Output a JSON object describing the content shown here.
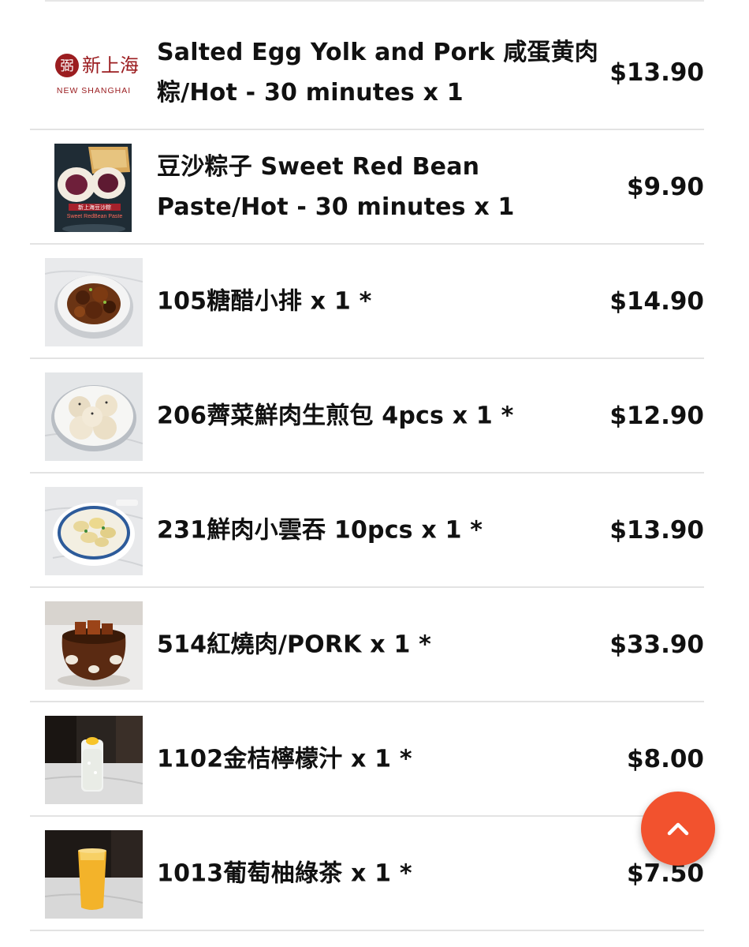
{
  "brand": {
    "logo_glyph": "弼",
    "logo_cn": "新上海",
    "logo_en": "NEW SHANGHAI"
  },
  "photo_text": {
    "cn": "新上海豆沙粽",
    "en": "Sweet RedBean Paste"
  },
  "colors": {
    "accent": "#f2522e",
    "brand_red": "#9b1d20",
    "text": "#111111",
    "divider": "#e3e3e3"
  },
  "scroll_top_button": {
    "icon": "chevron-up-icon"
  },
  "order_items": [
    {
      "title": "Salted Egg Yolk and Pork 咸蛋黄肉粽/Hot - 30 minutes x 1",
      "price": "$13.90",
      "thumb": "new-shanghai-logo"
    },
    {
      "title": "豆沙粽子 Sweet Red Bean Paste/Hot - 30 minutes x 1",
      "price": "$9.90",
      "thumb": "red-bean-zongzi-photo"
    },
    {
      "title": "105糖醋小排 x 1 *",
      "price": "$14.90",
      "thumb": "sweet-sour-ribs-photo"
    },
    {
      "title": "206薺菜鮮肉生煎包 4pcs x 1 *",
      "price": "$12.90",
      "thumb": "pan-fried-buns-photo"
    },
    {
      "title": "231鮮肉小雲吞 10pcs x 1 *",
      "price": "$13.90",
      "thumb": "wonton-soup-photo"
    },
    {
      "title": "514紅燒肉/PORK x 1 *",
      "price": "$33.90",
      "thumb": "braised-pork-pot-photo"
    },
    {
      "title": "1102金桔檸檬汁 x 1 *",
      "price": "$8.00",
      "thumb": "kumquat-lemonade-photo"
    },
    {
      "title": "1013葡萄柚綠茶 x 1 *",
      "price": "$7.50",
      "thumb": "grapefruit-green-tea-photo"
    }
  ]
}
